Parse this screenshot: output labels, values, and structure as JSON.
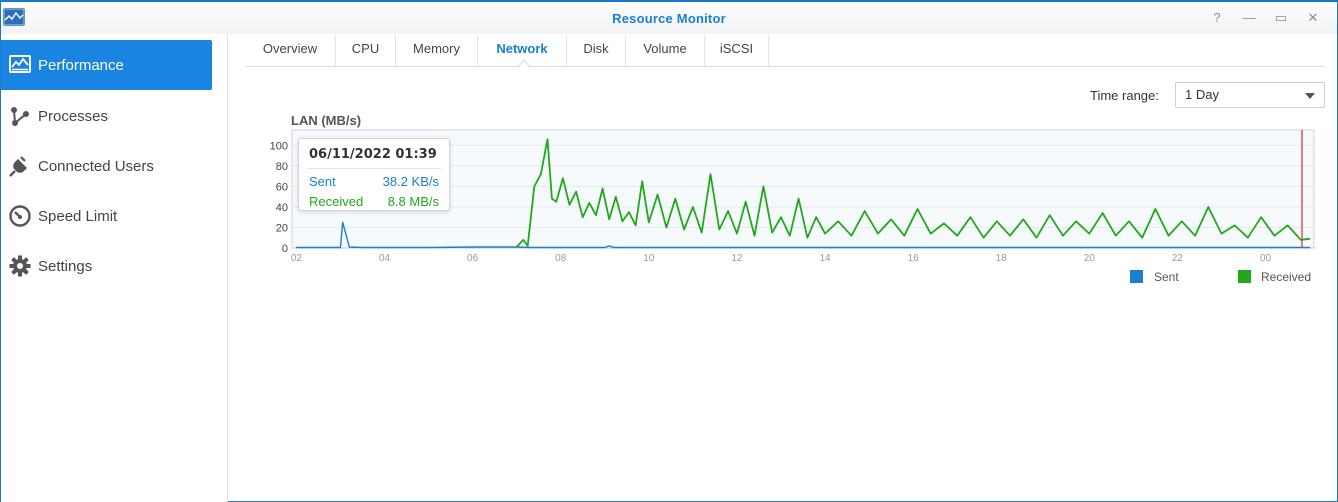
{
  "window": {
    "title": "Resource Monitor",
    "help_glyph": "?",
    "minimize_glyph": "—",
    "maximize_glyph": "▭",
    "close_glyph": "✕"
  },
  "sidebar": {
    "items": [
      {
        "label": "Performance",
        "icon": "performance-icon",
        "active": true
      },
      {
        "label": "Processes",
        "icon": "processes-icon",
        "active": false
      },
      {
        "label": "Connected Users",
        "icon": "plug-icon",
        "active": false
      },
      {
        "label": "Speed Limit",
        "icon": "speedometer-icon",
        "active": false
      },
      {
        "label": "Settings",
        "icon": "gear-icon",
        "active": false
      }
    ]
  },
  "tabs": [
    {
      "label": "Overview",
      "active": false
    },
    {
      "label": "CPU",
      "active": false
    },
    {
      "label": "Memory",
      "active": false
    },
    {
      "label": "Network",
      "active": true
    },
    {
      "label": "Disk",
      "active": false
    },
    {
      "label": "Volume",
      "active": false
    },
    {
      "label": "iSCSI",
      "active": false
    }
  ],
  "time_range": {
    "label": "Time range:",
    "selected": "1 Day"
  },
  "tooltip": {
    "date": "06/11/2022 01:39",
    "sent_label": "Sent",
    "sent_value": "38.2 KB/s",
    "received_label": "Received",
    "received_value": "8.8 MB/s"
  },
  "colors": {
    "accent": "#1a85e1",
    "sent": "#1a7fd0",
    "received": "#22a81a",
    "cursor_line": "#d93a3a"
  },
  "chart_data": {
    "type": "line",
    "title": "LAN (MB/s)",
    "xlabel": "",
    "ylabel": "",
    "ylim": [
      0,
      115
    ],
    "yticks": [
      0,
      20,
      40,
      60,
      80,
      100
    ],
    "x_tick_labels": [
      "02",
      "04",
      "06",
      "08",
      "10",
      "12",
      "14",
      "16",
      "18",
      "20",
      "22",
      "00"
    ],
    "x_range_hours": [
      1.9,
      25.1
    ],
    "grid": true,
    "legend_position": "bottom-right",
    "series": [
      {
        "name": "Sent",
        "color": "#1a7fd0",
        "x": [
          2.0,
          3.0,
          3.05,
          3.2,
          3.5,
          5.0,
          6.0,
          7.0,
          7.3,
          9.0,
          9.1,
          9.2,
          25.0
        ],
        "values": [
          0.5,
          0.5,
          25,
          1,
          0.5,
          0.5,
          1,
          1,
          0.5,
          0.5,
          2,
          0.5,
          0.5
        ]
      },
      {
        "name": "Received",
        "color": "#22a81a",
        "x": [
          7.0,
          7.15,
          7.25,
          7.4,
          7.55,
          7.7,
          7.8,
          7.9,
          8.05,
          8.2,
          8.35,
          8.5,
          8.65,
          8.8,
          8.95,
          9.1,
          9.25,
          9.4,
          9.55,
          9.7,
          9.85,
          10.0,
          10.2,
          10.4,
          10.6,
          10.8,
          11.0,
          11.2,
          11.4,
          11.6,
          11.8,
          12.0,
          12.2,
          12.4,
          12.6,
          12.8,
          13.0,
          13.2,
          13.4,
          13.6,
          13.8,
          14.0,
          14.3,
          14.6,
          14.9,
          15.2,
          15.5,
          15.8,
          16.1,
          16.4,
          16.7,
          17.0,
          17.3,
          17.6,
          17.9,
          18.2,
          18.5,
          18.8,
          19.1,
          19.4,
          19.7,
          20.0,
          20.3,
          20.6,
          20.9,
          21.2,
          21.5,
          21.8,
          22.1,
          22.4,
          22.7,
          23.0,
          23.3,
          23.6,
          23.9,
          24.2,
          24.5,
          24.8,
          25.0
        ],
        "values": [
          1,
          8,
          2,
          60,
          72,
          106,
          48,
          45,
          68,
          42,
          55,
          30,
          44,
          32,
          58,
          28,
          50,
          26,
          35,
          22,
          65,
          25,
          52,
          20,
          48,
          18,
          40,
          15,
          72,
          18,
          36,
          14,
          45,
          12,
          60,
          15,
          30,
          12,
          48,
          10,
          30,
          14,
          26,
          12,
          36,
          14,
          28,
          12,
          38,
          14,
          24,
          12,
          30,
          10,
          26,
          12,
          28,
          10,
          32,
          12,
          26,
          14,
          34,
          12,
          26,
          10,
          38,
          12,
          26,
          12,
          40,
          14,
          22,
          10,
          30,
          12,
          22,
          8,
          9
        ]
      }
    ]
  }
}
